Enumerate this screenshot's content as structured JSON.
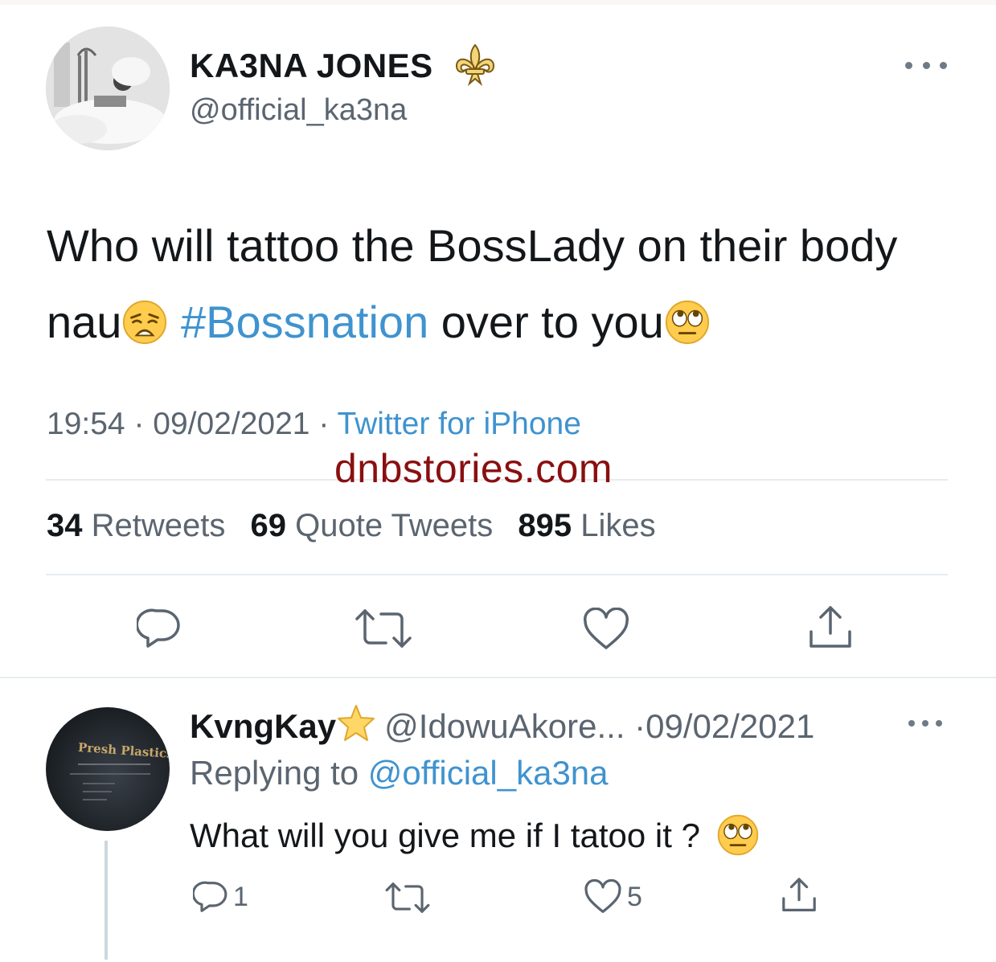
{
  "main_tweet": {
    "display_name": "KA3NA JONES",
    "handle": "@official_ka3na",
    "text_part1": "Who will tattoo the BossLady on their body nau",
    "hashtag": "#Bossnation",
    "text_part2": " over to you",
    "time": "19:54",
    "date": "09/02/2021",
    "separator": " · ",
    "source": "Twitter for iPhone",
    "stats": {
      "retweets_count": "34",
      "retweets_label": "Retweets",
      "quote_count": "69",
      "quote_label": "Quote Tweets",
      "likes_count": "895",
      "likes_label": "Likes"
    }
  },
  "watermark": "dnbstories.com",
  "reply": {
    "display_name": "KvngKay",
    "handle": "@IdowuAkore...",
    "date": "·09/02/2021",
    "replying_prefix": "Replying to",
    "replying_handle": "@official_ka3na",
    "text": "What will you give me if I tatoo it ?",
    "reply_count": "1",
    "like_count": "5",
    "avatar_text": "Presh Plastics"
  },
  "colors": {
    "accent": "#3f93cf",
    "secondary_text": "#5b6570",
    "watermark": "#8a0f10",
    "divider": "#e6ecf0"
  },
  "icons": [
    "fleur-de-lis-icon",
    "more-icon",
    "weary-face-emoji",
    "rolling-eyes-emoji",
    "reply-icon",
    "retweet-icon",
    "like-icon",
    "share-icon",
    "star-emoji"
  ]
}
